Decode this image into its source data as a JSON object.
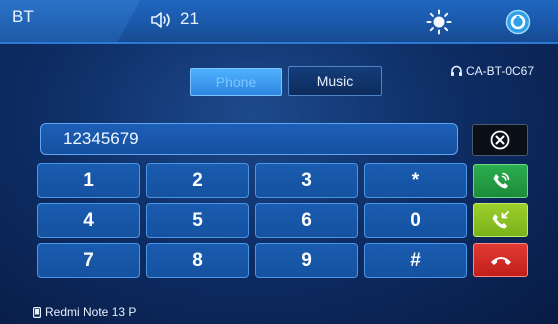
{
  "topbar": {
    "bt_label": "BT",
    "volume_value": "21"
  },
  "tabs": {
    "phone_label": "Phone",
    "music_label": "Music"
  },
  "device_id": "CA-BT-0C67",
  "number_display": "12345679",
  "keypad": {
    "rows": [
      [
        "1",
        "2",
        "3",
        "*"
      ],
      [
        "4",
        "5",
        "6",
        "0"
      ],
      [
        "7",
        "8",
        "9",
        "#"
      ]
    ]
  },
  "connected_device": "Redmi Note 13 P",
  "colors": {
    "background": "#0e2e66",
    "topbar": "#1a57a8",
    "call_green": "#2cae4f",
    "accept_lime": "#9ccf2a",
    "end_red": "#e23a32"
  },
  "icons": {
    "volume": "speaker-icon",
    "brightness": "sun-icon",
    "settings": "settings-icon",
    "clear": "clear-circle-x-icon",
    "call": "phone-call-icon",
    "accept": "phone-incoming-icon",
    "end": "phone-hangup-icon",
    "device": "mobile-phone-icon",
    "bluetooth_device": "headset-icon"
  }
}
